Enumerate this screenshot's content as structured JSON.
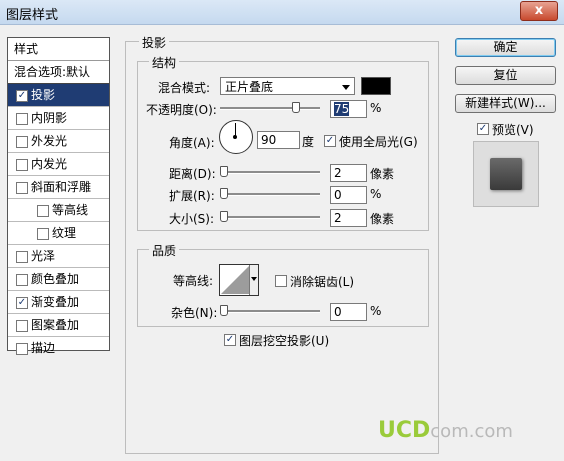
{
  "window": {
    "title": "图层样式",
    "close_glyph": "x"
  },
  "stylelist": {
    "header": "样式",
    "blend_default": "混合选项:默认",
    "items": [
      {
        "label": "投影",
        "checked": true
      },
      {
        "label": "内阴影",
        "checked": false
      },
      {
        "label": "外发光",
        "checked": false
      },
      {
        "label": "内发光",
        "checked": false
      },
      {
        "label": "斜面和浮雕",
        "checked": false
      },
      {
        "label": "等高线",
        "checked": false
      },
      {
        "label": "纹理",
        "checked": false
      },
      {
        "label": "光泽",
        "checked": false
      },
      {
        "label": "颜色叠加",
        "checked": false
      },
      {
        "label": "渐变叠加",
        "checked": true
      },
      {
        "label": "图案叠加",
        "checked": false
      },
      {
        "label": "描边",
        "checked": false
      }
    ],
    "selected": "投影"
  },
  "panel": {
    "title": "投影",
    "structure": {
      "title": "结构",
      "blend_mode_label": "混合模式:",
      "blend_mode_value": "正片叠底",
      "blend_color": "#000000",
      "opacity_label": "不透明度(O):",
      "opacity_value": "75",
      "opacity_unit": "%",
      "opacity_level": 75,
      "angle_label": "角度(A):",
      "angle_value": "90",
      "angle_unit": "度",
      "use_global_light_label": "使用全局光(G)",
      "use_global_light_checked": true,
      "distance_label": "距离(D):",
      "distance_value": "2",
      "distance_unit": "像素",
      "spread_label": "扩展(R):",
      "spread_value": "0",
      "spread_unit": "%",
      "size_label": "大小(S):",
      "size_value": "2",
      "size_unit": "像素"
    },
    "quality": {
      "title": "品质",
      "contour_label": "等高线:",
      "antialias_label": "消除锯齿(L)",
      "antialias_checked": false,
      "noise_label": "杂色(N):",
      "noise_value": "0",
      "noise_unit": "%"
    },
    "knockout_label": "图层挖空投影(U)",
    "knockout_checked": true
  },
  "buttons": {
    "ok": "确定",
    "reset": "复位",
    "new_style": "新建样式(W)...",
    "preview_label": "预览(V)",
    "preview_checked": true
  },
  "watermark": {
    "brand": "UCD",
    "domain": "com.com"
  }
}
